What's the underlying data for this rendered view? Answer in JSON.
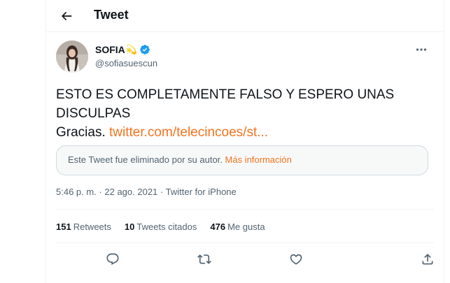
{
  "header": {
    "title": "Tweet",
    "back_icon": "arrow-left-icon"
  },
  "author": {
    "display_name": "SOFIA",
    "emoji": "💫",
    "handle": "@sofiasuescun",
    "verified_icon": "verified-badge-icon",
    "more_icon": "more-dots-icon"
  },
  "tweet": {
    "line1": "ESTO ES COMPLETAMENTE FALSO Y ESPERO UNAS",
    "line2": "DISCULPAS",
    "line3_prefix": "Gracias. ",
    "link": "twitter.com/telecincoes/st..."
  },
  "quoted": {
    "notice": "Este Tweet fue eliminado por su autor. ",
    "more_info": "Más información"
  },
  "meta": {
    "time": "5:46 p. m.",
    "separator1": " · ",
    "date": "22 ago. 2021",
    "separator2": " · ",
    "source": "Twitter for iPhone"
  },
  "stats": {
    "retweets_count": "151",
    "retweets_label": "Retweets",
    "quotes_count": "10",
    "quotes_label": "Tweets citados",
    "likes_count": "476",
    "likes_label": "Me gusta"
  },
  "actions": [
    "reply-icon",
    "retweet-icon",
    "like-icon",
    "share-icon"
  ],
  "colors": {
    "accent": "#f4731e",
    "verified": "#1d9bf0",
    "muted": "#536471",
    "text": "#0f1419"
  }
}
